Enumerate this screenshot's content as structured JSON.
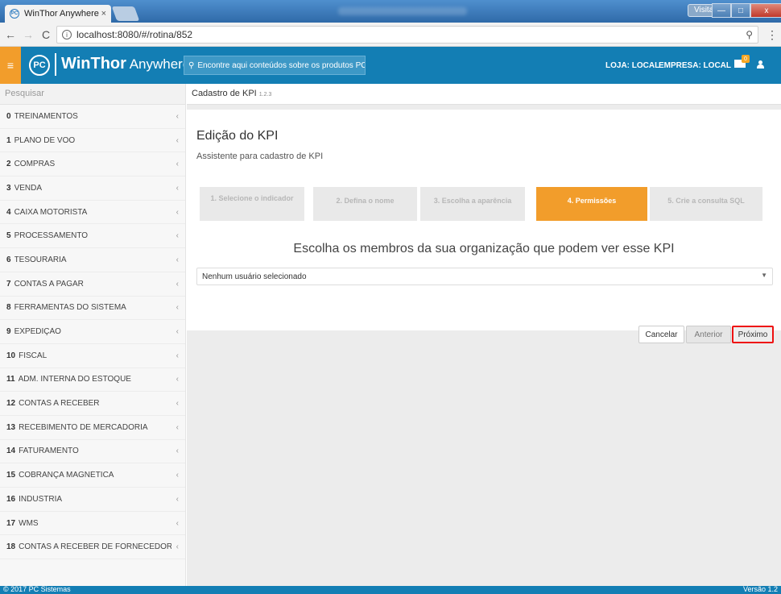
{
  "browser": {
    "tab_title": "WinThor Anywhere",
    "tab_close": "×",
    "favicon_text": "PC",
    "visitor_label": "Visitante",
    "window_controls": [
      "—",
      "□",
      "x"
    ],
    "url": "localhost:8080/#/rotina/852",
    "nav": {
      "back": "←",
      "forward": "→",
      "reload": "C",
      "info": "i",
      "zoom": "⚲",
      "menu": "⋮"
    }
  },
  "header": {
    "menu_icon": "≡",
    "logo_text": "PC",
    "brand_bold": "WinThor",
    "brand_light": " Anywhere",
    "search_placeholder": "Encontre aqui conteúdos sobre os produtos PC",
    "search_icon": "⚲",
    "loja": "LOJA: LOCAL",
    "empresa": "EMPRESA: LOCAL",
    "mail_badge": "0",
    "accent_color": "#137eb4",
    "highlight_color": "#f29d2b"
  },
  "sidebar": {
    "search_placeholder": "Pesquisar",
    "items": [
      {
        "num": "0",
        "label": "TREINAMENTOS"
      },
      {
        "num": "1",
        "label": "PLANO DE VOO"
      },
      {
        "num": "2",
        "label": "COMPRAS"
      },
      {
        "num": "3",
        "label": "VENDA"
      },
      {
        "num": "4",
        "label": "CAIXA MOTORISTA"
      },
      {
        "num": "5",
        "label": "PROCESSAMENTO"
      },
      {
        "num": "6",
        "label": "TESOURARIA"
      },
      {
        "num": "7",
        "label": "CONTAS A PAGAR"
      },
      {
        "num": "8",
        "label": "FERRAMENTAS DO SISTEMA"
      },
      {
        "num": "9",
        "label": "EXPEDIÇÃO"
      },
      {
        "num": "10",
        "label": "FISCAL"
      },
      {
        "num": "11",
        "label": "ADM. INTERNA DO ESTOQUE"
      },
      {
        "num": "12",
        "label": "CONTAS A RECEBER"
      },
      {
        "num": "13",
        "label": "RECEBIMENTO DE MERCADORIA"
      },
      {
        "num": "14",
        "label": "FATURAMENTO"
      },
      {
        "num": "15",
        "label": "COBRANÇA MAGNÉTICA"
      },
      {
        "num": "16",
        "label": "INDUSTRIA"
      },
      {
        "num": "17",
        "label": "WMS"
      },
      {
        "num": "18",
        "label": "CONTAS A RECEBER DE FORNECEDOR"
      }
    ],
    "chevron": "‹"
  },
  "main": {
    "breadcrumb": "Cadastro de KPI",
    "version_small": "1.2.3",
    "title": "Edição do KPI",
    "subtitle": "Assistente para cadastro de KPI",
    "steps": [
      {
        "label": "1. Selecione o indicador",
        "active": false
      },
      {
        "label": "2. Defina o nome",
        "active": false
      },
      {
        "label": "3. Escolha a aparência",
        "active": false
      },
      {
        "label": "4. Permissões",
        "active": true
      },
      {
        "label": "5. Crie a consulta SQL",
        "active": false
      }
    ],
    "question": "Escolha os membros da sua organização que podem ver esse KPI",
    "select_value": "Nenhum usuário selecionado",
    "select_caret": "▼",
    "buttons": {
      "cancel": "Cancelar",
      "previous": "Anterior",
      "next": "Próximo"
    }
  },
  "footer": {
    "copyright": "© 2017 PC Sistemas",
    "version": "Versão 1.2"
  }
}
